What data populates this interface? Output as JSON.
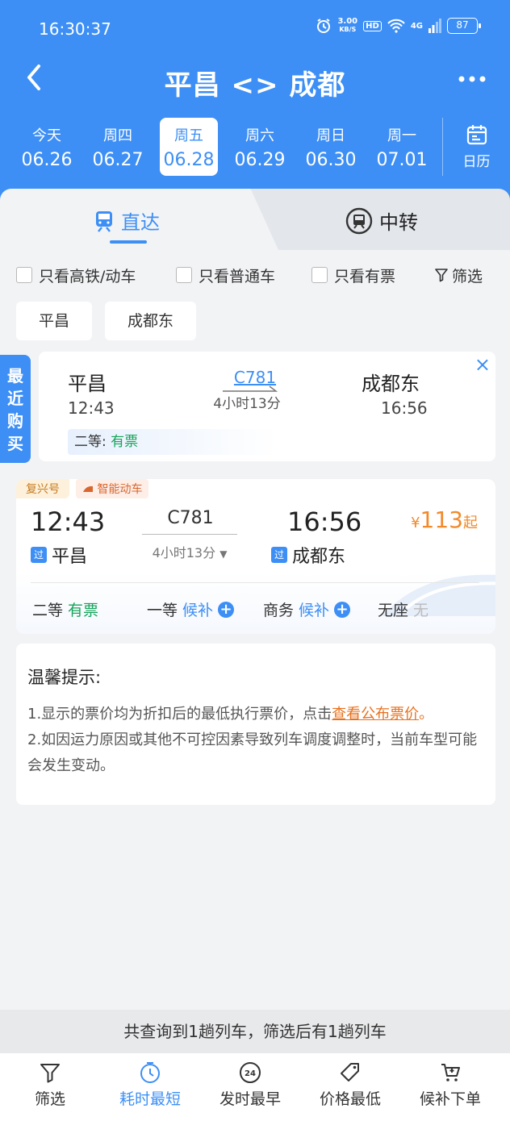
{
  "status_bar": {
    "time": "16:30:37",
    "speed_value": "3.00",
    "speed_unit": "KB/S",
    "hd": "HD",
    "network": "4G",
    "battery": "87"
  },
  "nav": {
    "title": "平昌 <> 成都"
  },
  "dates": [
    {
      "weekday": "今天",
      "date": "06.26"
    },
    {
      "weekday": "周四",
      "date": "06.27"
    },
    {
      "weekday": "周五",
      "date": "06.28"
    },
    {
      "weekday": "周六",
      "date": "06.29"
    },
    {
      "weekday": "周日",
      "date": "06.30"
    },
    {
      "weekday": "周一",
      "date": "07.01"
    }
  ],
  "calendar_label": "日历",
  "tabs": {
    "direct": "直达",
    "transfer": "中转"
  },
  "filters": {
    "high_speed": "只看高铁/动车",
    "normal": "只看普通车",
    "available": "只看有票",
    "filter": "筛选"
  },
  "stations": [
    "平昌",
    "成都东"
  ],
  "recent": {
    "tab_label": "最近购买",
    "from": "平昌",
    "from_time": "12:43",
    "train": "C781",
    "duration": "4小时13分",
    "to": "成都东",
    "to_time": "16:56",
    "seat_class": "二等:",
    "seat_status": "有票",
    "close": "×"
  },
  "train": {
    "badge_type": "复兴号",
    "badge_smart": "智能动车",
    "depart": "12:43",
    "arrive": "16:56",
    "number": "C781",
    "duration": "4小时13分",
    "pass_label": "过",
    "from": "平昌",
    "to": "成都东",
    "price_symbol": "¥",
    "price": "113",
    "price_suffix": "起",
    "seats": [
      {
        "name": "二等",
        "status": "有票"
      },
      {
        "name": "一等",
        "status": "候补"
      },
      {
        "name": "商务",
        "status": "候补"
      },
      {
        "name": "无座",
        "status": "无"
      }
    ]
  },
  "tips": {
    "title": "温馨提示:",
    "line1_pre": "1.显示的票价均为折扣后的最低执行票价，点击",
    "line1_link": "查看公布票价",
    "line1_post": "。",
    "line2": "2.如因运力原因或其他不可控因素导致列车调度调整时，当前车型可能会发生变动。"
  },
  "summary": "共查询到1趟列车，筛选后有1趟列车",
  "bottom_bar": [
    {
      "label": "筛选",
      "icon": "funnel-icon"
    },
    {
      "label": "耗时最短",
      "icon": "clock-icon"
    },
    {
      "label": "发时最早",
      "icon": "24h-icon"
    },
    {
      "label": "价格最低",
      "icon": "price-tag-icon"
    },
    {
      "label": "候补下单",
      "icon": "waitlist-cart-icon"
    }
  ],
  "colors": {
    "brand_blue": "#3d8ff5",
    "available_green": "#16a35b",
    "price_orange": "#f28a2a"
  }
}
